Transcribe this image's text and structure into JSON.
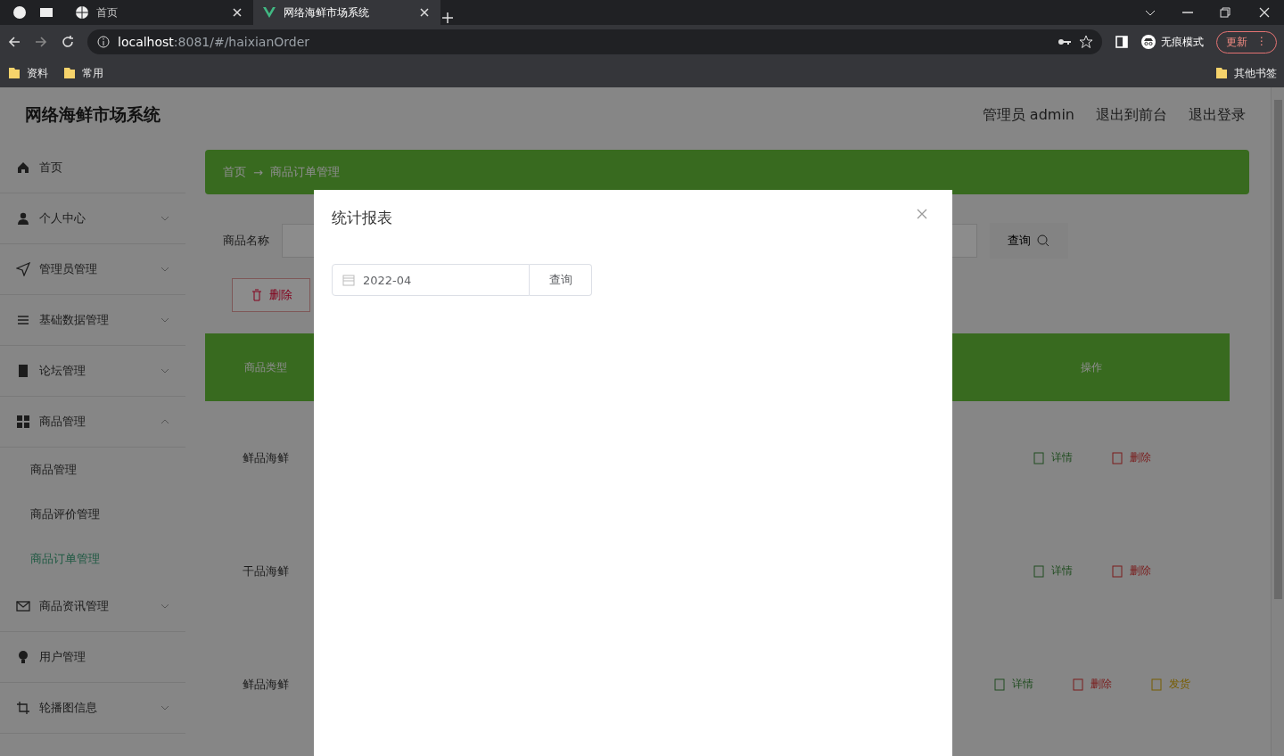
{
  "browser": {
    "tabs": [
      {
        "title": "首页",
        "selected": false
      },
      {
        "title": "网络海鲜市场系统",
        "selected": true
      }
    ],
    "url": {
      "host": "localhost",
      "rest": ":8081/#/haixianOrder"
    },
    "incognito": "无痕模式",
    "update": "更新",
    "menu": "⋮",
    "bookmarks": [
      "资料",
      "常用"
    ],
    "other_bookmarks": "其他书签"
  },
  "app": {
    "title": "网络海鲜市场系统",
    "header_links": [
      "管理员 admin",
      "退出到前台",
      "退出登录"
    ],
    "sidebar": [
      {
        "label": "首页",
        "expandable": false
      },
      {
        "label": "个人中心",
        "expandable": true,
        "expanded": false
      },
      {
        "label": "管理员管理",
        "expandable": true,
        "expanded": false
      },
      {
        "label": "基础数据管理",
        "expandable": true,
        "expanded": false
      },
      {
        "label": "论坛管理",
        "expandable": true,
        "expanded": false
      },
      {
        "label": "商品管理",
        "expandable": true,
        "expanded": true,
        "children": [
          {
            "label": "商品管理",
            "selected": false
          },
          {
            "label": "商品评价管理",
            "selected": false
          },
          {
            "label": "商品订单管理",
            "selected": true
          }
        ]
      },
      {
        "label": "商品资讯管理",
        "expandable": true,
        "expanded": false
      },
      {
        "label": "用户管理",
        "expandable": false
      },
      {
        "label": "轮播图信息",
        "expandable": true,
        "expanded": false
      }
    ],
    "breadcrumb": {
      "separator": "→",
      "items": [
        "首页",
        "商品订单管理"
      ]
    },
    "search": {
      "label": "商品名称",
      "button": "查询"
    },
    "delete_button": "删除",
    "table": {
      "columns": [
        "商品类型",
        "操作"
      ],
      "rows": [
        {
          "type": "鲜品海鲜",
          "actions": [
            {
              "label": "详情",
              "kind": "detail"
            },
            {
              "label": "删除",
              "kind": "delete"
            }
          ]
        },
        {
          "type": "干品海鲜",
          "actions": [
            {
              "label": "详情",
              "kind": "detail"
            },
            {
              "label": "删除",
              "kind": "delete"
            }
          ]
        },
        {
          "type": "鲜品海鲜",
          "actions": [
            {
              "label": "详情",
              "kind": "detail"
            },
            {
              "label": "删除",
              "kind": "delete"
            },
            {
              "label": "发货",
              "kind": "ship"
            }
          ]
        }
      ]
    }
  },
  "modal": {
    "title": "统计报表",
    "month": "2022-04",
    "button": "查询"
  }
}
